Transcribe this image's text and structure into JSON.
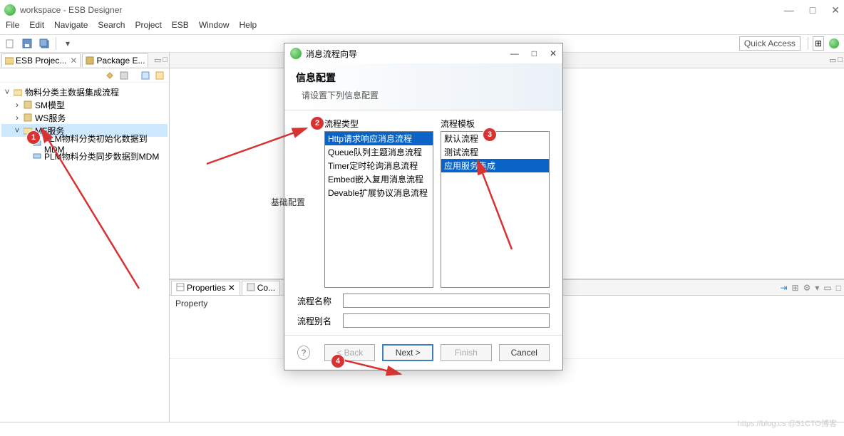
{
  "window": {
    "title": "workspace - ESB Designer",
    "controls": {
      "min": "—",
      "max": "□",
      "close": "✕"
    }
  },
  "menu": [
    "File",
    "Edit",
    "Navigate",
    "Search",
    "Project",
    "ESB",
    "Window",
    "Help"
  ],
  "toolbar": {
    "quick_access": "Quick Access"
  },
  "left_panel": {
    "tabs": [
      {
        "label": "ESB Projec...",
        "closable": true
      },
      {
        "label": "Package E..."
      }
    ],
    "tree": {
      "root": "物料分类主数据集成流程",
      "children": [
        {
          "label": "SM模型"
        },
        {
          "label": "WS服务"
        },
        {
          "label": "MF服务",
          "selected": true,
          "children": [
            {
              "label": "PLM物料分类初始化数据到MDM"
            },
            {
              "label": "PLM物料分类同步数据到MDM"
            }
          ]
        }
      ]
    }
  },
  "props": {
    "tab1": "Properties",
    "tab2": "Co...",
    "col1": "Property"
  },
  "dialog": {
    "title": "消息流程向导",
    "heading": "信息配置",
    "subtitle": "请设置下列信息配置",
    "col_type_label": "流程类型",
    "col_tmpl_label": "流程模板",
    "side_label": "基础配置",
    "types": [
      "Http请求响应消息流程",
      "Queue队列主题消息流程",
      "Timer定时轮询消息流程",
      "Embed嵌入复用消息流程",
      "Devable扩展协议消息流程"
    ],
    "templates": [
      "默认流程",
      "测试流程",
      "应用服务集成"
    ],
    "field_name_label": "流程名称",
    "field_alias_label": "流程别名",
    "field_name_value": "",
    "field_alias_value": "",
    "buttons": {
      "help": "?",
      "back": "< Back",
      "next": "Next >",
      "finish": "Finish",
      "cancel": "Cancel"
    }
  },
  "annotations": {
    "b1": "1",
    "b2": "2",
    "b3": "3",
    "b4": "4"
  },
  "watermark": "https://blog.cs @51CTO博客"
}
